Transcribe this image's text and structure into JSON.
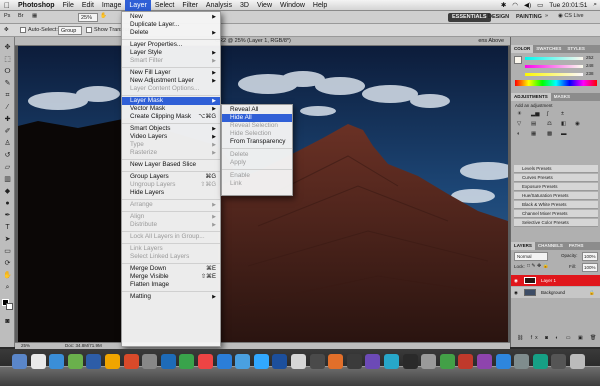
{
  "menubar": {
    "app_name": "Photoshop",
    "items": [
      "File",
      "Edit",
      "Image",
      "Layer",
      "Select",
      "Filter",
      "Analysis",
      "3D",
      "View",
      "Window",
      "Help"
    ],
    "active_item": "Layer",
    "clock": "Tue 20:01:51"
  },
  "appbar": {
    "zoom": "25%",
    "workspaces": [
      "ESSENTIALS",
      "DESIGN",
      "PAINTING"
    ],
    "more": "»",
    "cs_live": "CS Live"
  },
  "options": {
    "auto_select_label": "Auto-Select:",
    "auto_select_value": "Group",
    "show_transform_label": "Show Transform"
  },
  "document": {
    "tab_title": "CR2 @ 25% (Layer 1, RGB/8*)",
    "arrange_hint": "ens Above"
  },
  "status": {
    "zoom": "25%",
    "doc_info": "Doc: 34.8M/71.9M"
  },
  "layer_menu": {
    "items": [
      {
        "label": "New",
        "arrow": true
      },
      {
        "label": "Duplicate Layer..."
      },
      {
        "label": "Delete",
        "arrow": true
      },
      {
        "sep": true
      },
      {
        "label": "Layer Properties..."
      },
      {
        "label": "Layer Style",
        "arrow": true
      },
      {
        "label": "Smart Filter",
        "disabled": true,
        "arrow": true
      },
      {
        "sep": true
      },
      {
        "label": "New Fill Layer",
        "arrow": true
      },
      {
        "label": "New Adjustment Layer",
        "arrow": true
      },
      {
        "label": "Layer Content Options...",
        "disabled": true
      },
      {
        "sep": true
      },
      {
        "label": "Layer Mask",
        "arrow": true,
        "highlighted": true
      },
      {
        "label": "Vector Mask",
        "arrow": true
      },
      {
        "label": "Create Clipping Mask",
        "shortcut": "⌥⌘G"
      },
      {
        "sep": true
      },
      {
        "label": "Smart Objects",
        "arrow": true
      },
      {
        "label": "Video Layers",
        "arrow": true
      },
      {
        "label": "Type",
        "disabled": true,
        "arrow": true
      },
      {
        "label": "Rasterize",
        "disabled": true,
        "arrow": true
      },
      {
        "sep": true
      },
      {
        "label": "New Layer Based Slice"
      },
      {
        "sep": true
      },
      {
        "label": "Group Layers",
        "shortcut": "⌘G"
      },
      {
        "label": "Ungroup Layers",
        "disabled": true,
        "shortcut": "⇧⌘G"
      },
      {
        "label": "Hide Layers"
      },
      {
        "sep": true
      },
      {
        "label": "Arrange",
        "disabled": true,
        "arrow": true
      },
      {
        "sep": true
      },
      {
        "label": "Align",
        "disabled": true,
        "arrow": true
      },
      {
        "label": "Distribute",
        "disabled": true,
        "arrow": true
      },
      {
        "sep": true
      },
      {
        "label": "Lock All Layers in Group...",
        "disabled": true
      },
      {
        "sep": true
      },
      {
        "label": "Link Layers",
        "disabled": true
      },
      {
        "label": "Select Linked Layers",
        "disabled": true
      },
      {
        "sep": true
      },
      {
        "label": "Merge Down",
        "shortcut": "⌘E"
      },
      {
        "label": "Merge Visible",
        "shortcut": "⇧⌘E"
      },
      {
        "label": "Flatten Image"
      },
      {
        "sep": true
      },
      {
        "label": "Matting",
        "arrow": true
      }
    ]
  },
  "submenu": {
    "items": [
      {
        "label": "Reveal All"
      },
      {
        "label": "Hide All",
        "highlighted": true
      },
      {
        "label": "Reveal Selection",
        "disabled": true
      },
      {
        "label": "Hide Selection",
        "disabled": true
      },
      {
        "label": "From Transparency"
      },
      {
        "sep": true
      },
      {
        "label": "Delete",
        "disabled": true
      },
      {
        "label": "Apply",
        "disabled": true
      },
      {
        "sep": true
      },
      {
        "label": "Enable",
        "disabled": true
      },
      {
        "label": "Link",
        "disabled": true
      }
    ]
  },
  "color_panel": {
    "tabs": [
      "COLOR",
      "SWATCHES",
      "STYLES"
    ],
    "r": "252",
    "g": "248",
    "b": "238"
  },
  "adjustments_panel": {
    "tabs": [
      "ADJUSTMENTS",
      "MASKS"
    ],
    "subtitle": "Add an adjustment",
    "presets": [
      "Levels Presets",
      "Curves Presets",
      "Exposure Presets",
      "Hue/Saturation Presets",
      "Black & White Presets",
      "Channel Mixer Presets",
      "Selective Color Presets"
    ]
  },
  "layers_panel": {
    "tabs": [
      "LAYERS",
      "CHANNELS",
      "PATHS"
    ],
    "blend_mode": "Normal",
    "opacity_label": "Opacity:",
    "opacity_value": "100%",
    "lock_label": "Lock:",
    "fill_label": "Fill:",
    "fill_value": "100%",
    "layers": [
      {
        "name": "Layer 1",
        "selected": true
      },
      {
        "name": "Background",
        "selected": false
      }
    ]
  },
  "colors": {
    "menu_highlight": "#2f5fd6",
    "layer_selected": "#e0161b"
  }
}
